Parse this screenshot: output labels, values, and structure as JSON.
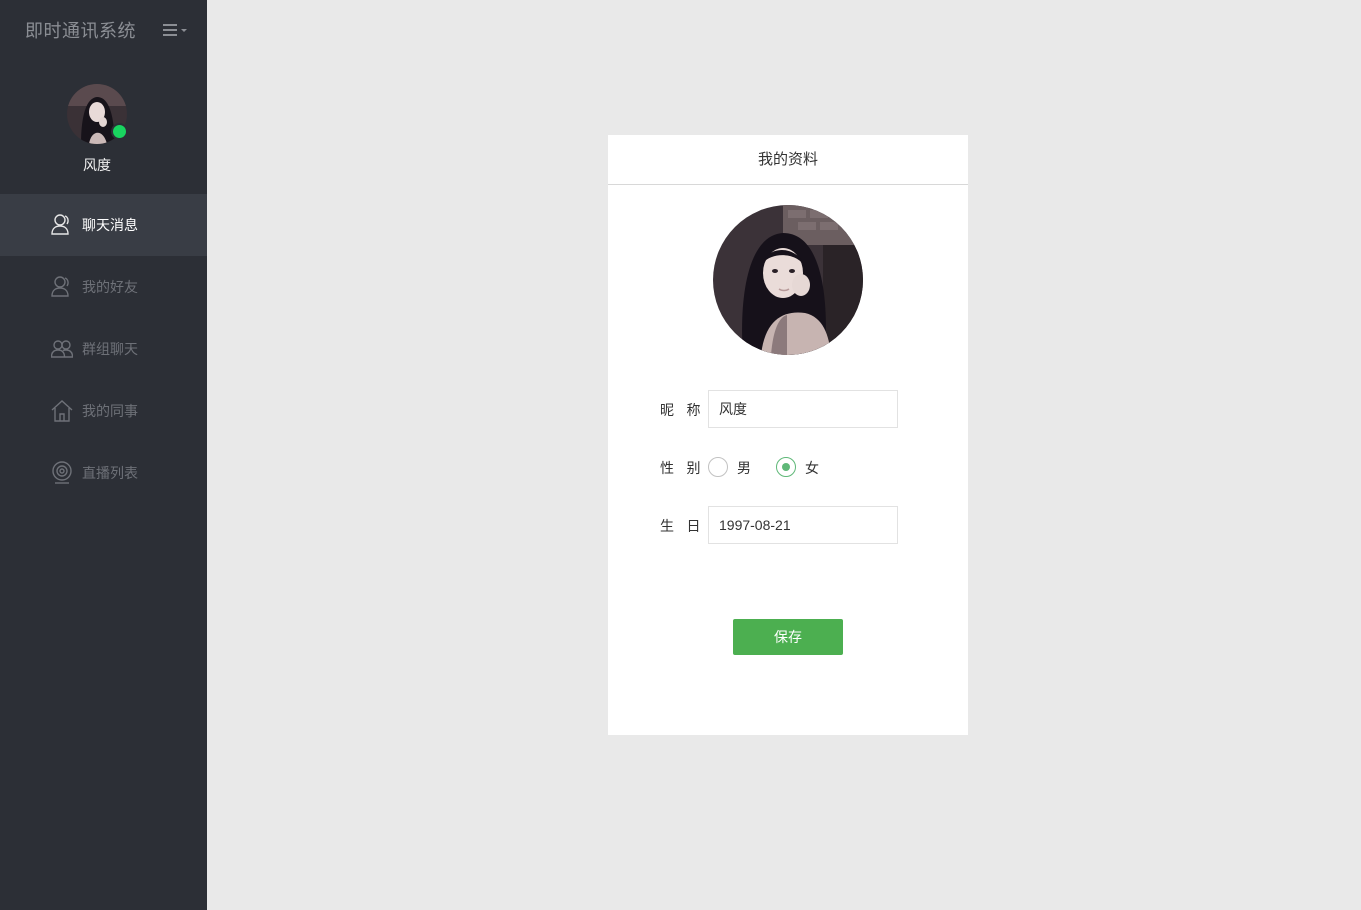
{
  "app": {
    "title": "即时通讯系统"
  },
  "user": {
    "name": "风度",
    "status": "online",
    "status_color": "#19d45f"
  },
  "nav": {
    "items": [
      {
        "label": "聊天消息",
        "icon": "user-icon",
        "active": true
      },
      {
        "label": "我的好友",
        "icon": "user-icon",
        "active": false
      },
      {
        "label": "群组聊天",
        "icon": "group-icon",
        "active": false
      },
      {
        "label": "我的同事",
        "icon": "home-icon",
        "active": false
      },
      {
        "label": "直播列表",
        "icon": "webcam-icon",
        "active": false
      }
    ]
  },
  "profile": {
    "title": "我的资料",
    "nickname_label": "昵 称",
    "nickname_value": "风度",
    "gender_label": "性 别",
    "gender_options": [
      "男",
      "女"
    ],
    "gender_selected": "女",
    "birthday_label": "生 日",
    "birthday_value": "1997-08-21",
    "save_label": "保存"
  },
  "colors": {
    "sidebar": "#2c2f36",
    "active_nav": "#393d45",
    "accent": "#4caf50",
    "radio": "#5fb878"
  }
}
